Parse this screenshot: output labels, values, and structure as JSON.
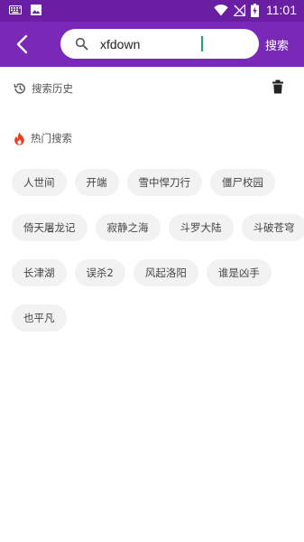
{
  "status_bar": {
    "time": "11:01",
    "left_icons": [
      "keyboard-icon",
      "image-icon"
    ],
    "right_icons": [
      "wifi-icon",
      "no-signal-icon",
      "battery-charging-icon"
    ]
  },
  "app_bar": {
    "background": "#7a28b8",
    "search_query": "xfdown",
    "search_button_label": "搜索"
  },
  "history": {
    "title": "搜索历史"
  },
  "hot": {
    "title": "热门搜索",
    "rows": [
      [
        "人世间",
        "开端",
        "雪中悍刀行",
        "僵尸校园"
      ],
      [
        "倚天屠龙记",
        "寂静之海",
        "斗罗大陆",
        "斗破苍穹"
      ],
      [
        "长津湖",
        "误杀2",
        "风起洛阳",
        "谁是凶手"
      ],
      [
        "也平凡"
      ]
    ]
  }
}
